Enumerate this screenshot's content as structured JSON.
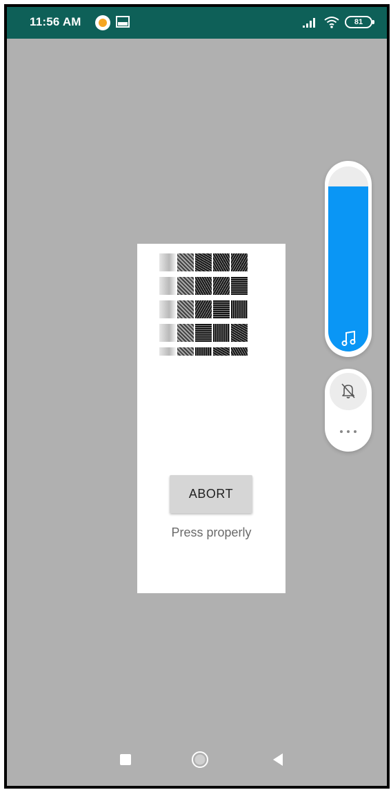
{
  "status_bar": {
    "time": "11:56 AM",
    "battery_level": "81",
    "icons": [
      "app-notification-icon",
      "image-icon",
      "signal-icon",
      "wifi-icon",
      "battery-icon"
    ]
  },
  "dialog": {
    "abort_label": "ABORT",
    "status_message": "Press properly"
  },
  "volume_panel": {
    "media_volume_level": 0.89,
    "icons": [
      "music-note-icon",
      "bell-off-icon",
      "more-icon"
    ]
  },
  "nav_bar": {
    "icons": [
      "recents-icon",
      "home-icon",
      "back-icon"
    ]
  },
  "colors": {
    "status_bar": "#0e6058",
    "background_dim": "#b0b0b0",
    "volume_fill": "#0a96f5",
    "button": "#d6d6d6"
  }
}
